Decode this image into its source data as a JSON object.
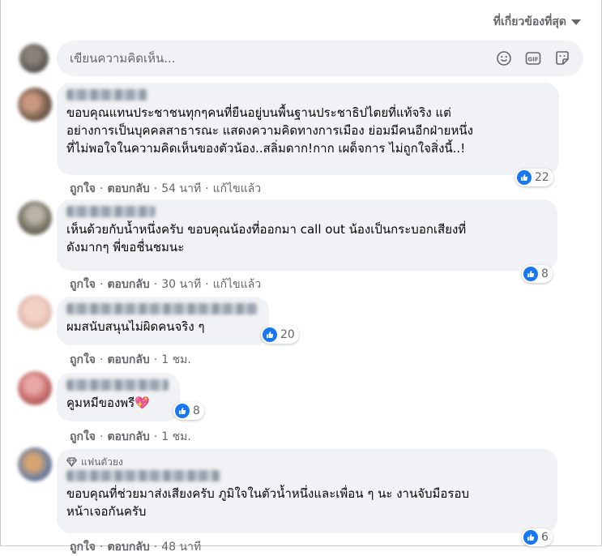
{
  "sort": {
    "label": "ที่เกี่ยวข้องที่สุด"
  },
  "composer": {
    "placeholder": "เขียนความคิดเห็น..."
  },
  "actions": {
    "like": "ถูกใจ",
    "reply": "ตอบกลับ",
    "edited": "แก้ไขแล้ว",
    "separator": "·"
  },
  "comments": [
    {
      "text": "ขอบคุณแทนประชาชนทุกๆคนที่ยืนอยู่บนพื้นฐานประชาธิปไตยที่แท้จริง แต่\nอย่างการเป็นบุคคลสาธารณะ แสดงความคิดทางการเมือง ย่อมมีคนอีกฝ่ายหนึ่ง\nที่ไม่พอใจในความคิดเห็นของตัวน้อง..สลิ่มดาก!กาก เผด็จการ ไม่ถูกใจสิ่งนี้..!",
      "time": "54 นาที",
      "likes": "22"
    },
    {
      "text": "เห็นด้วยกับน้ำหนึ่งครับ ขอบคุณน้องที่ออกมา call out น้องเป็นกระบอกเสียงที่\nดังมากๆ พี่ขอชื่นชมนะ",
      "time": "30 นาที",
      "likes": "8"
    },
    {
      "text": "ผมสนับสนุนไม่ผิดคนจริง ๆ",
      "time": "1 ชม.",
      "likes": "20"
    },
    {
      "text": "คูมหมีของพรี💖",
      "time": "1 ชม.",
      "likes": "8"
    },
    {
      "badge": "แฟนตัวยง",
      "text": "ขอบคุณที่ช่วยมาส่งเสียงครับ ภูมิใจในตัวน้ำหนึ่งและเพื่อน ๆ นะ งานจับมือรอบ\nหน้าเจอกันครับ",
      "time": "48 นาที",
      "likes": "6"
    }
  ],
  "icons": {
    "emoji": "smile-icon",
    "gif": "gif-icon",
    "sticker": "sticker-icon",
    "like": "like-icon",
    "badge": "diamond-icon",
    "sort": "caret-down-icon"
  },
  "colors": {
    "accent": "#1877f2",
    "bubble": "#f0f2f5",
    "meta": "#65676b"
  }
}
